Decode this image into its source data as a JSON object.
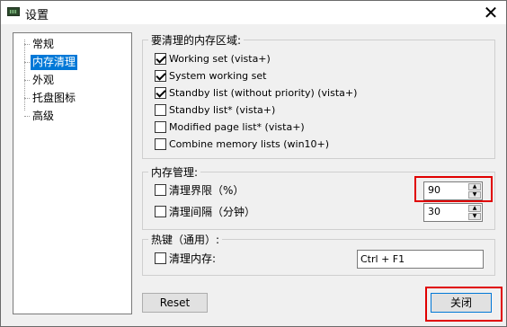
{
  "window": {
    "title": "设置"
  },
  "tree": {
    "items": [
      {
        "label": "常规"
      },
      {
        "label": "内存清理"
      },
      {
        "label": "外观"
      },
      {
        "label": "托盘图标"
      },
      {
        "label": "高级"
      }
    ],
    "selected": "内存清理"
  },
  "memory_regions": {
    "title": "要清理的内存区域:",
    "options": [
      {
        "label": "Working set (vista+)",
        "checked": true
      },
      {
        "label": "System working set",
        "checked": true
      },
      {
        "label": "Standby list (without priority) (vista+)",
        "checked": true
      },
      {
        "label": "Standby list* (vista+)",
        "checked": false
      },
      {
        "label": "Modified page list* (vista+)",
        "checked": false
      },
      {
        "label": "Combine memory lists (win10+)",
        "checked": false
      }
    ]
  },
  "memory_management": {
    "title": "内存管理:",
    "limit_label": "清理界限（%）",
    "limit_checked": false,
    "limit_value": "90",
    "interval_label": "清理间隔（分钟）",
    "interval_checked": false,
    "interval_value": "30"
  },
  "hotkey": {
    "title": "热键（通用）:",
    "label": "清理内存:",
    "checked": false,
    "value": "Ctrl + F1"
  },
  "buttons": {
    "reset": "Reset",
    "close": "关闭"
  },
  "colors": {
    "selection": "#0078d7",
    "highlight": "#e00000"
  }
}
